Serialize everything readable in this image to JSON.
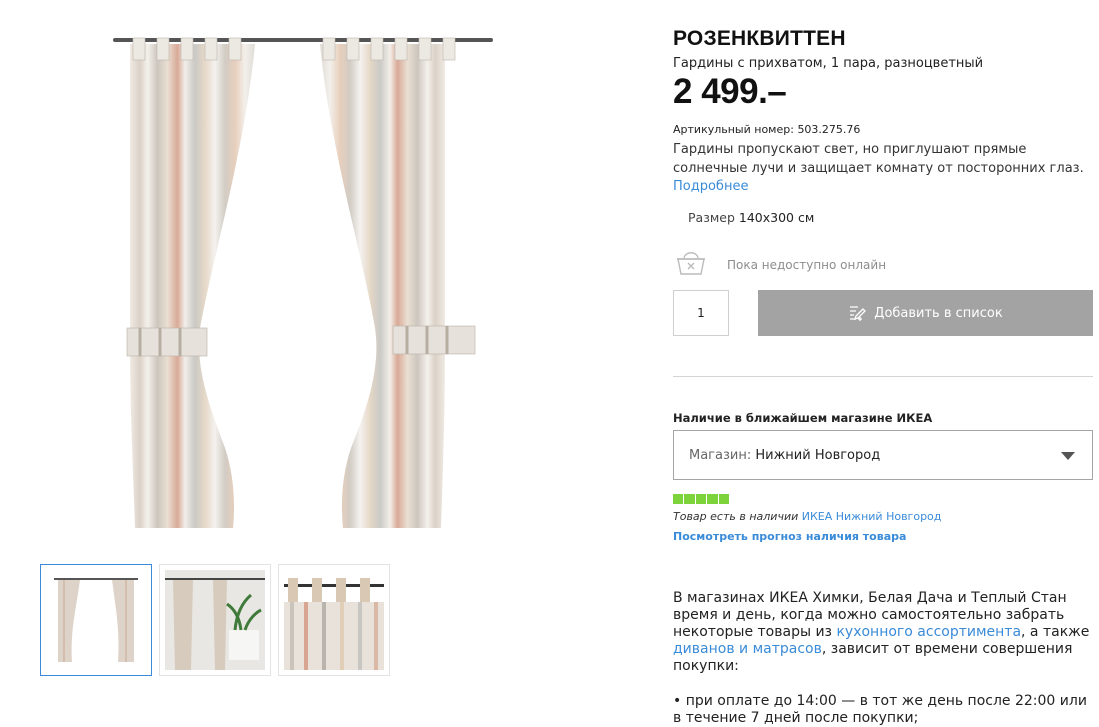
{
  "product": {
    "name": "РОЗЕНКВИТТЕН",
    "description": "Гардины с прихватом, 1 пара, разноцветный",
    "price": "2 499.–",
    "article_label": "Артикульный номер:",
    "article_number": "503.275.76",
    "text": "Гардины пропускают свет, но приглушают прямые солнечные лучи и защищает комнату от посторонних глаз.",
    "more_link": "Подробнее",
    "size_label": "Размер",
    "size_value": "140x300 см"
  },
  "purchase": {
    "online_status": "Пока недоступно онлайн",
    "quantity": "1",
    "add_to_list_label": "Добавить в список"
  },
  "stock": {
    "heading": "Наличие в ближайшем магазине ИКЕА",
    "store_label": "Магазин:",
    "store_value": "Нижний Новгород",
    "level": 5,
    "level_max": 5,
    "availability_text": "Товар есть в наличии",
    "availability_store": "ИКЕА Нижний Новгород",
    "forecast_link": "Посмотреть прогноз наличия товара"
  },
  "info": {
    "p1_start": "В магазинах ИКЕА Химки, Белая Дача и Теплый Стан время и день, когда можно самостоятельно забрать некоторые товары из ",
    "p1_link1": "кухонного ассортимента",
    "p1_mid": ", а также ",
    "p1_link2": "диванов и матрасов",
    "p1_end": ", зависит от времени совершения покупки:",
    "bullet1": "• при оплате до 14:00 — в тот же день после 22:00 или в течение 7 дней после покупки;"
  },
  "gallery": {
    "thumbnails": [
      "curtains-pair",
      "curtains-room",
      "curtains-closeup"
    ],
    "active_index": 0
  },
  "colors": {
    "link": "#3a8bd8",
    "button_disabled": "#a3a3a3",
    "stock_green": "#7cd33a",
    "active_thumb_border": "#3a8bd8"
  }
}
